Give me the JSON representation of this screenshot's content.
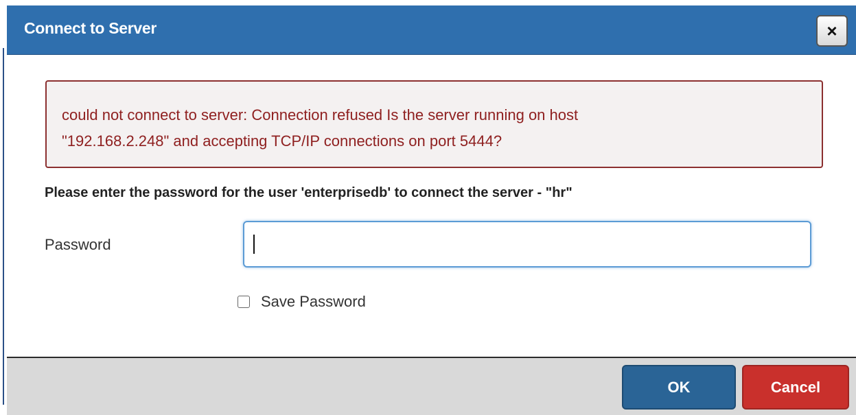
{
  "dialog": {
    "title": "Connect to Server",
    "close_label": "×"
  },
  "error": {
    "line1": "could not connect to server: Connection refused Is the server running on host",
    "line2": "\"192.168.2.248\" and accepting TCP/IP connections on port 5444?"
  },
  "prompt": "Please enter the password for the user 'enterprisedb' to connect the server - \"hr\"",
  "password_field": {
    "label": "Password",
    "value": ""
  },
  "save_password": {
    "label": "Save Password",
    "checked": false
  },
  "buttons": {
    "ok": "OK",
    "cancel": "Cancel"
  },
  "colors": {
    "titlebar": "#2f6fae",
    "error_text": "#8f2020",
    "ok_button": "#2a6496",
    "cancel_button": "#c9302c"
  },
  "icons": {
    "close": "close-icon"
  }
}
